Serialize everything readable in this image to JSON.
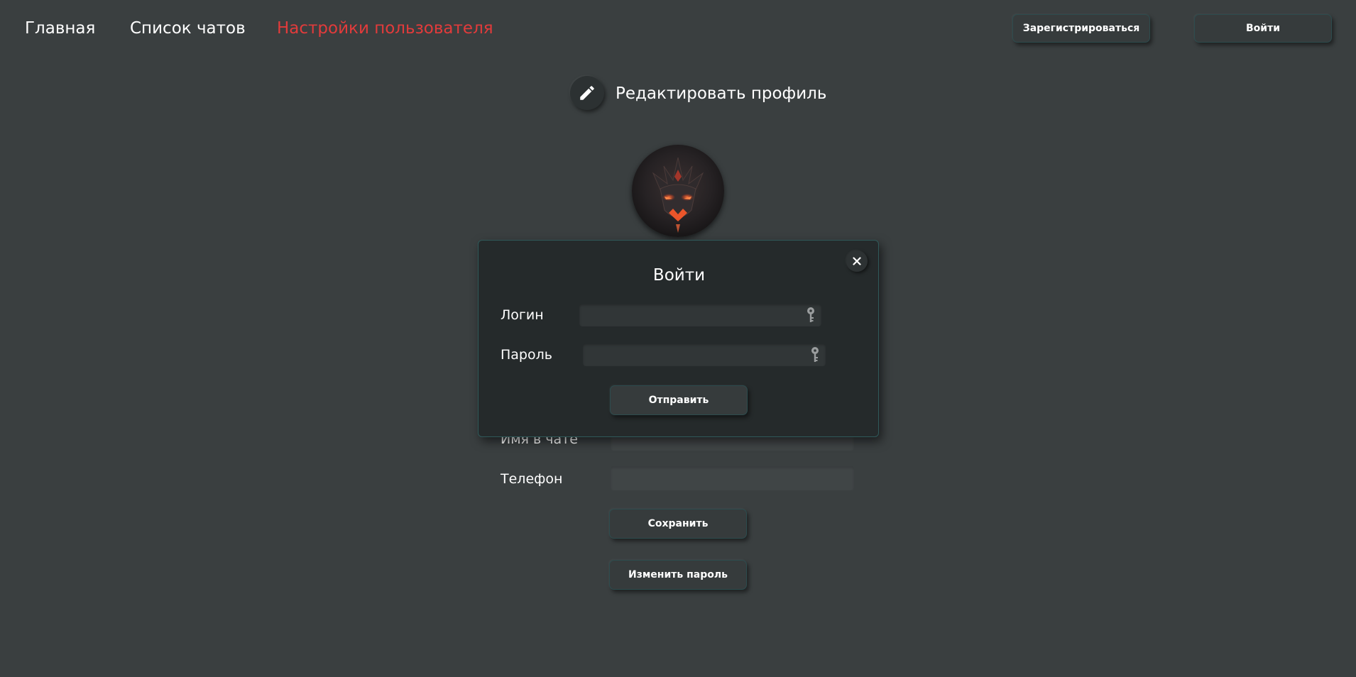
{
  "nav": {
    "home": "Главная",
    "chats": "Список чатов",
    "settings": "Настройки пользователя",
    "register_button": "Зарегистрироваться",
    "login_button": "Войти"
  },
  "profile": {
    "edit_title": "Редактировать профиль",
    "edit_icon": "pencil-icon",
    "avatar": "demon-face-avatar",
    "fields": {
      "chat_name_label": "Имя в чате",
      "phone_label": "Телефон"
    },
    "save_button": "Сохранить",
    "change_password_button": "Изменить пароль"
  },
  "modal": {
    "title": "Войти",
    "close_icon": "close-icon",
    "login_label": "Логин",
    "login_value": "",
    "password_label": "Пароль",
    "password_value": "",
    "field_icon": "key-icon",
    "submit_button": "Отправить"
  },
  "colors": {
    "background": "#3a3f40",
    "modal_background": "#252a2b",
    "active_nav": "#e23b3b",
    "button_border": "#2d4c4e"
  }
}
